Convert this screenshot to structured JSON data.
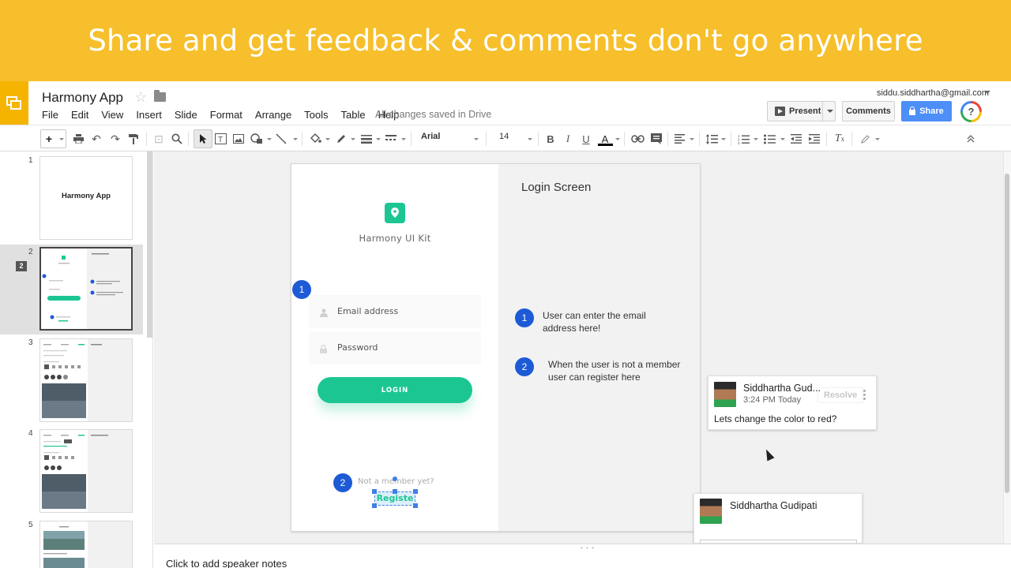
{
  "banner": {
    "text": "Share and get feedback & comments don't go anywhere"
  },
  "header": {
    "doc_title": "Harmony App",
    "menus": [
      "File",
      "Edit",
      "View",
      "Insert",
      "Slide",
      "Format",
      "Arrange",
      "Tools",
      "Table",
      "Help"
    ],
    "save_status": "All changes saved in Drive",
    "account_email": "siddu.siddhartha@gmail.com",
    "present_label": "Present",
    "comments_label": "Comments",
    "share_label": "Share",
    "help_label": "?"
  },
  "toolbar": {
    "font_family": "Arial",
    "font_size": "14",
    "bold": "B",
    "italic": "I",
    "underline": "U",
    "text_color": "A"
  },
  "filmstrip": {
    "slides": [
      {
        "num": "1",
        "title": "Harmony App"
      },
      {
        "num": "2",
        "title": ""
      },
      {
        "num": "3",
        "title": ""
      },
      {
        "num": "4",
        "title": ""
      },
      {
        "num": "5",
        "title": ""
      }
    ],
    "selected_badge": "2"
  },
  "slide": {
    "brand_name": "Harmony UI Kit",
    "email_placeholder": "Email address",
    "password_placeholder": "Password",
    "login_label": "LOGIN",
    "not_member": "Not a member yet?",
    "register": "Registe",
    "right_title": "Login Screen",
    "markers": [
      "1",
      "2"
    ],
    "notes": [
      {
        "num": "1",
        "text": "User can enter the email address here!"
      },
      {
        "num": "2",
        "text": "When the user is not a member user can register here"
      }
    ]
  },
  "comments": [
    {
      "author": "Siddhartha Gud...",
      "time": "3:24 PM Today",
      "text": "Lets change the color to red?",
      "resolve": "Resolve"
    },
    {
      "author": "Siddhartha Gudipati"
    }
  ],
  "speaker_notes": {
    "placeholder": "Click to add speaker notes"
  },
  "colors": {
    "banner": "#f6bf2b",
    "accent_green": "#1cc693",
    "marker_blue": "#1d5ad6",
    "share_blue": "#4d8ef7"
  }
}
